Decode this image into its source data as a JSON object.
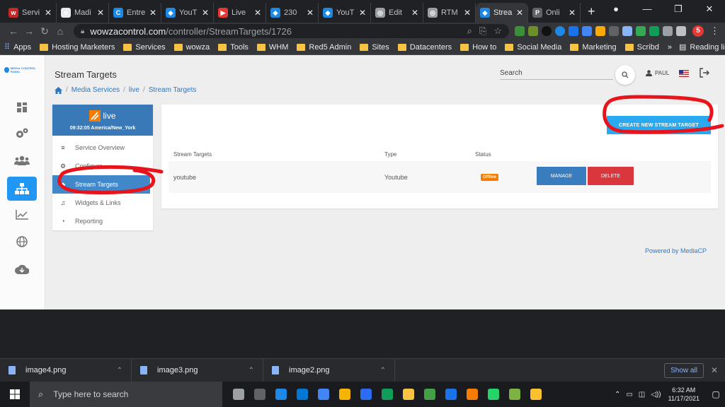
{
  "browser": {
    "tabs": [
      {
        "label": "Servi",
        "color": "#c62828",
        "glyph": "w"
      },
      {
        "label": "Madi",
        "color": "#e8eaed",
        "glyph": "d"
      },
      {
        "label": "Entre",
        "color": "#1e88e5",
        "glyph": "C"
      },
      {
        "label": "YouT",
        "color": "#1e88e5",
        "glyph": "◆"
      },
      {
        "label": "Live",
        "color": "#e53935",
        "glyph": "▶"
      },
      {
        "label": "230",
        "color": "#1e88e5",
        "glyph": "◆"
      },
      {
        "label": "YouT",
        "color": "#1e88e5",
        "glyph": "◆"
      },
      {
        "label": "Edit",
        "color": "#9aa0a6",
        "glyph": "◎"
      },
      {
        "label": "RTM",
        "color": "#9aa0a6",
        "glyph": "◎"
      },
      {
        "label": "Strea",
        "color": "#1e88e5",
        "glyph": "◆",
        "active": true
      },
      {
        "label": "Onli",
        "color": "#5f6368",
        "glyph": "P"
      }
    ],
    "new_tab": "+",
    "url_host": "wowzacontrol.com",
    "url_path": "/controller/StreamTargets/1726",
    "profile_initial": "5",
    "bookmarks": [
      "Apps",
      "Hosting Marketers",
      "Services",
      "wowza",
      "Tools",
      "WHM",
      "Red5 Admin",
      "Sites",
      "Datacenters",
      "How to",
      "Social Media",
      "Marketing",
      "Scribd"
    ],
    "bookmarks_more": "»",
    "reading_list": "Reading list"
  },
  "app": {
    "header_title": "Stream Targets",
    "breadcrumbs": [
      "Media Services",
      "live",
      "Stream Targets"
    ],
    "search_label": "Search",
    "user_name": "PAUL",
    "logo_text": "MEDIA CONTROL PANEL",
    "service": {
      "name": "live",
      "time": "09:32:05 America/New_York",
      "menu": [
        {
          "label": "Service Overview",
          "icon": "≡"
        },
        {
          "label": "Configure",
          "icon": "⚙"
        },
        {
          "label": "Stream Targets",
          "icon": "◆",
          "active": true
        },
        {
          "label": "Widgets & Links",
          "icon": "♫"
        },
        {
          "label": "Reporting",
          "icon": "◔"
        }
      ]
    },
    "create_button": "CREATE NEW STREAM TARGET",
    "table": {
      "headers": [
        "Stream Targets",
        "Type",
        "Status"
      ],
      "rows": [
        {
          "name": "youtube",
          "type": "Youtube",
          "status": "Offline",
          "manage": "MANAGE",
          "delete": "DELETE"
        }
      ]
    },
    "powered_by": "Powered by MediaCP"
  },
  "downloads": {
    "items": [
      "image4.png",
      "image3.png",
      "image2.png"
    ],
    "show_all": "Show all"
  },
  "taskbar": {
    "search_placeholder": "Type here to search",
    "time": "6:32 AM",
    "date": "11/17/2021"
  }
}
